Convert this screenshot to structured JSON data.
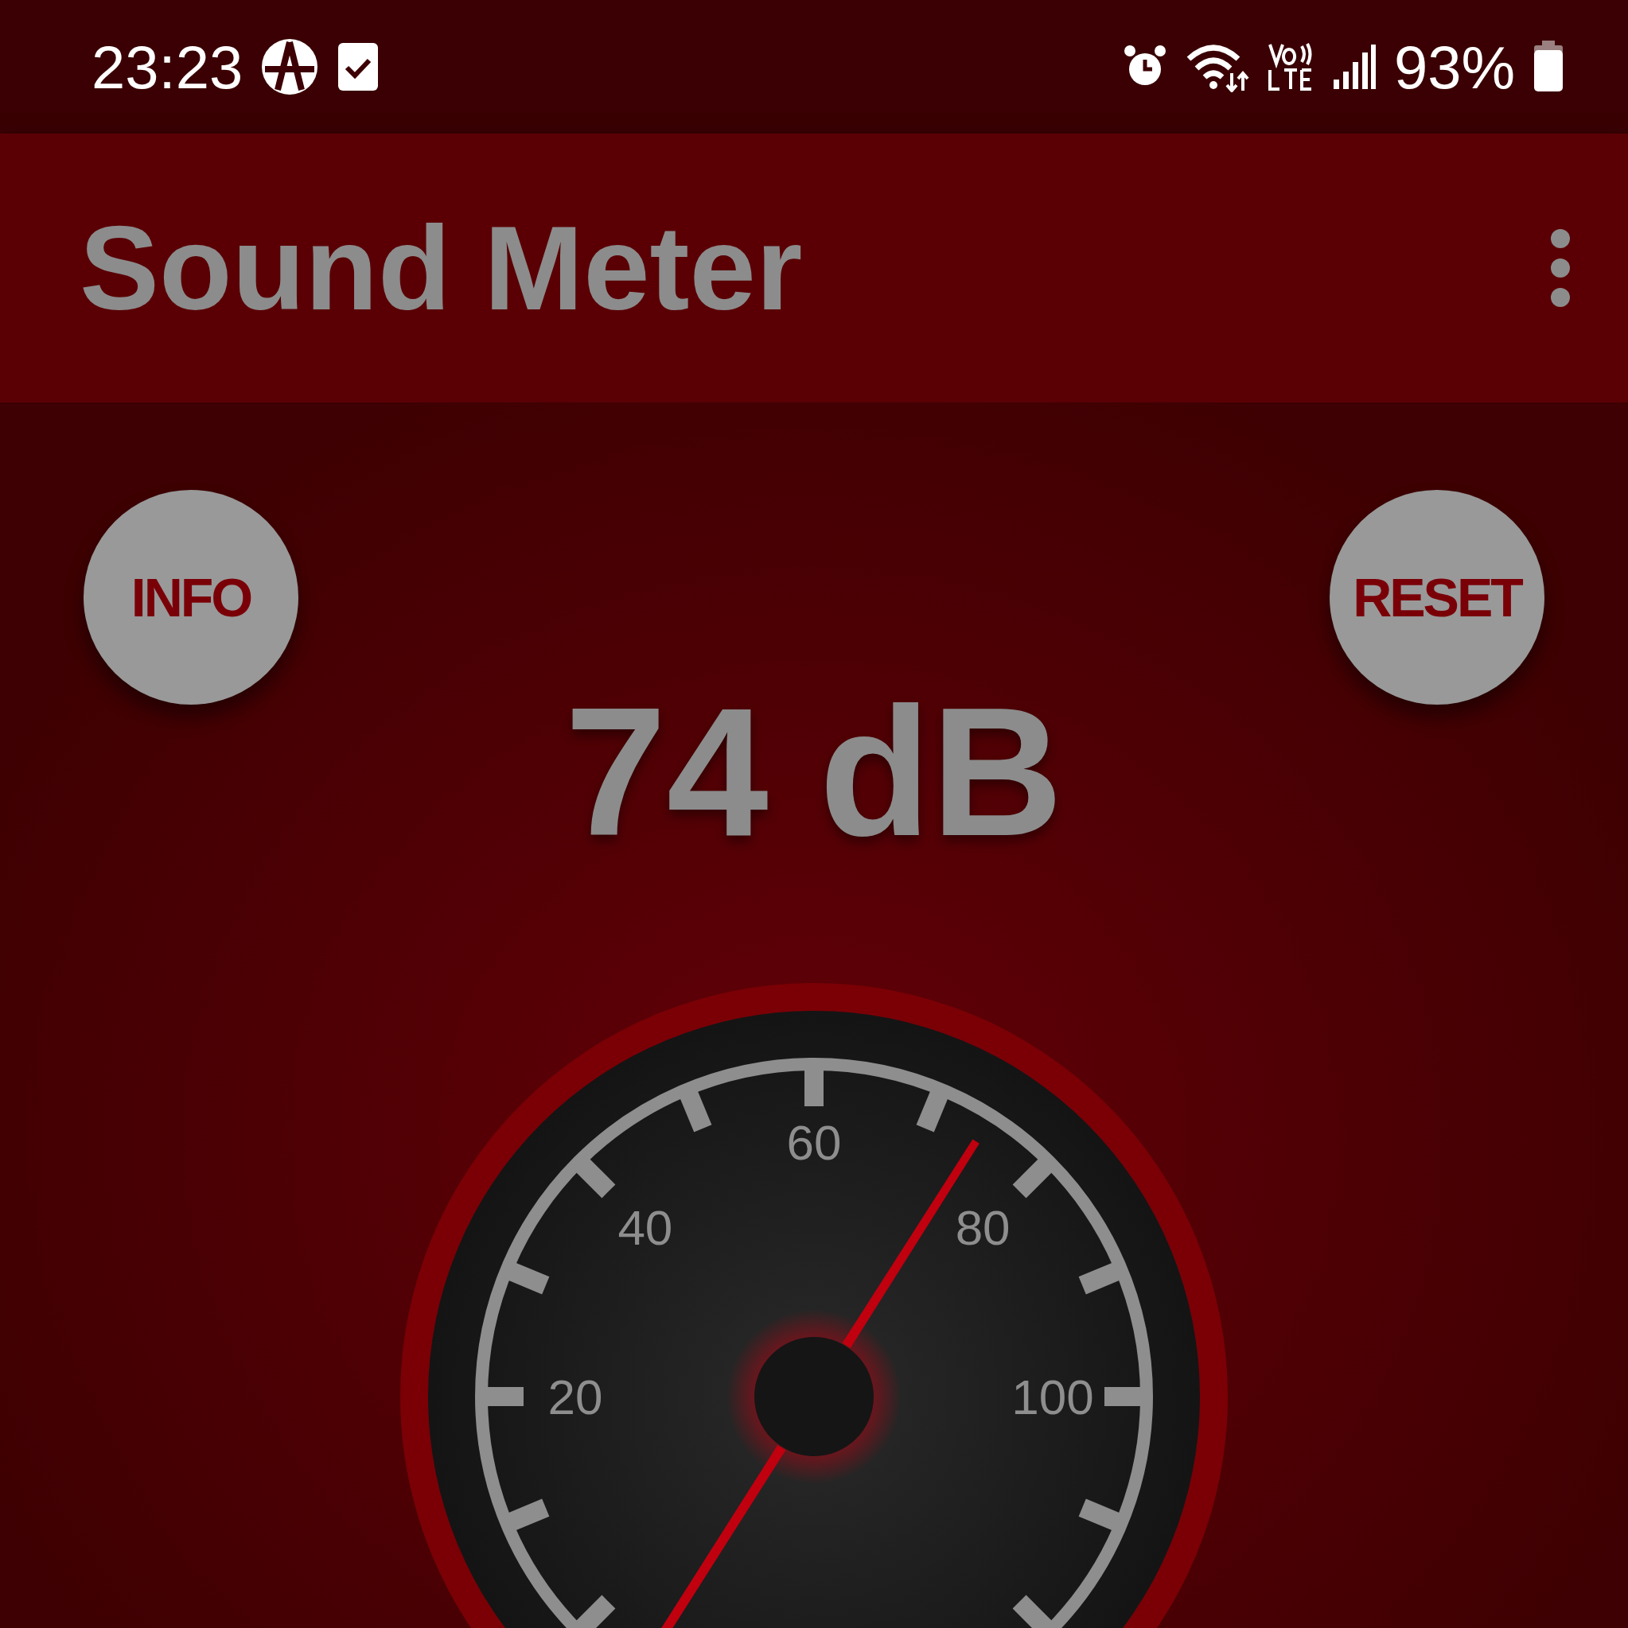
{
  "status_bar": {
    "time": "23:23",
    "battery": "93%"
  },
  "app_bar": {
    "title": "Sound Meter"
  },
  "buttons": [
    {
      "label": "INFO"
    },
    {
      "label": "RESET"
    }
  ],
  "reading": "74 dB",
  "gauge": {
    "labels": [
      "20",
      "40",
      "60",
      "80",
      "100"
    ]
  }
}
